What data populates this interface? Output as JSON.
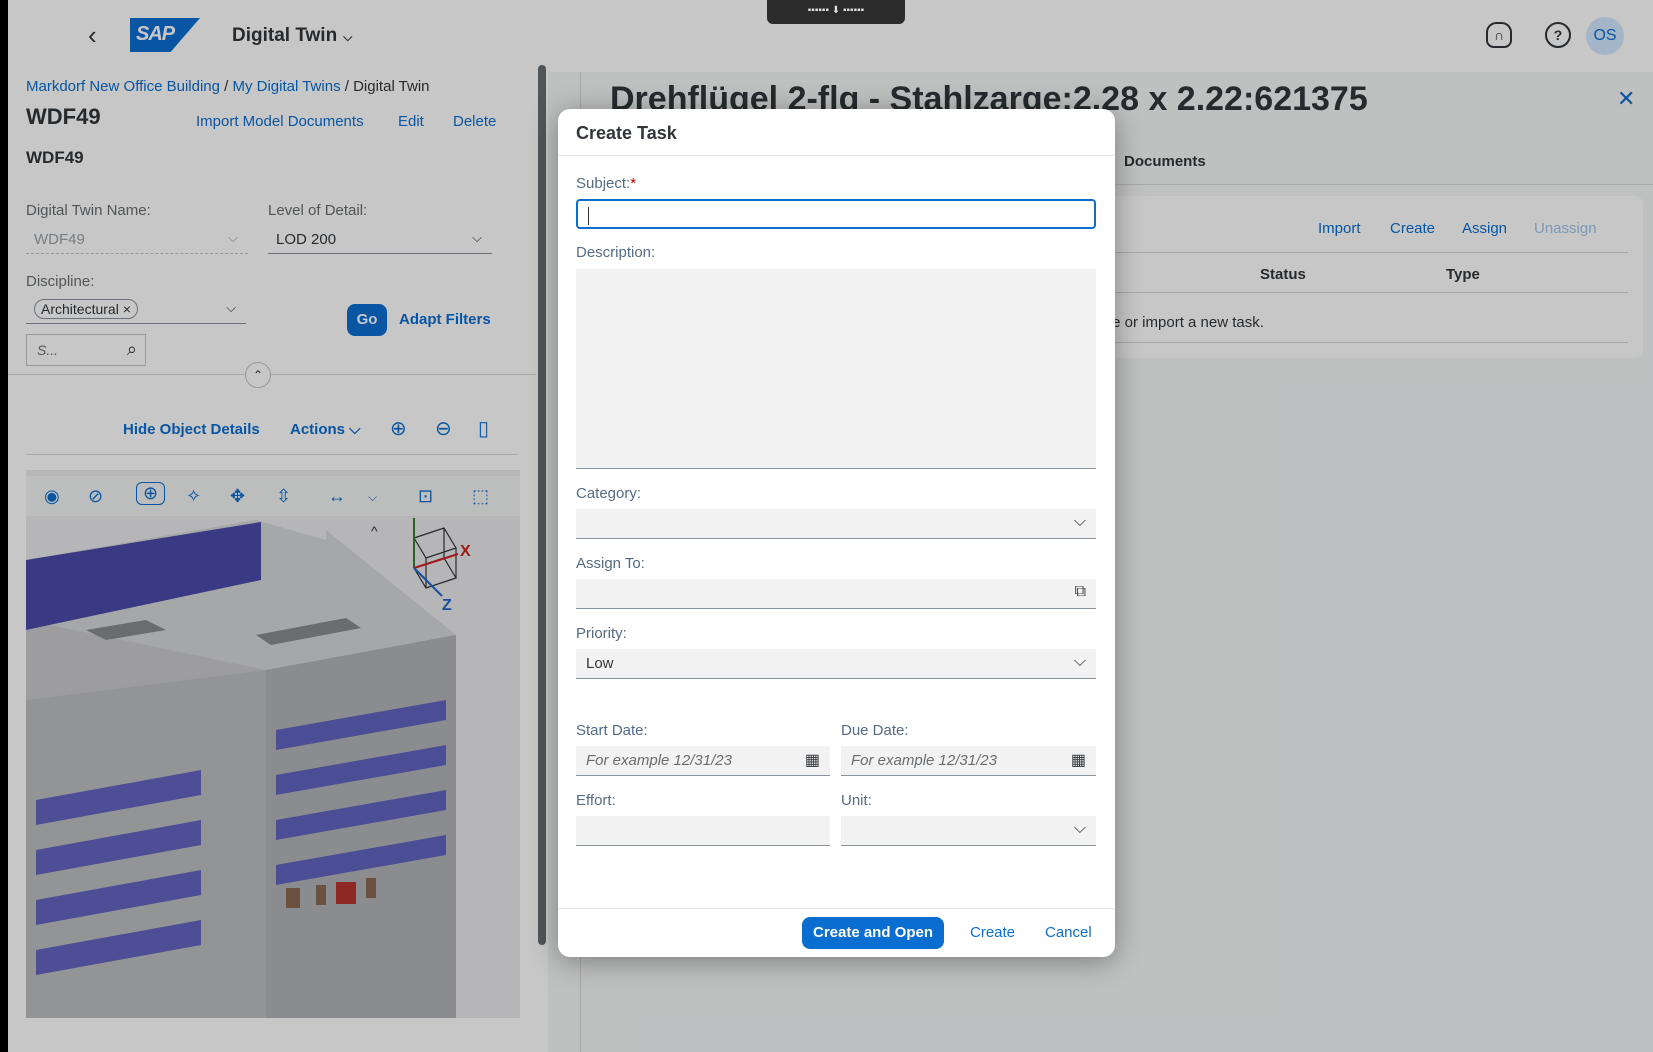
{
  "shell": {
    "app_title": "Digital Twin",
    "avatar_initials": "OS",
    "notch_text": "▪▪▪▪▪▪ ⬇ ▪▪▪▪▪▪"
  },
  "breadcrumb": {
    "items": [
      "Markdorf New Office Building",
      "My Digital Twins"
    ],
    "current": "Digital Twin",
    "separator": " / "
  },
  "header": {
    "title": "WDF49",
    "subtitle": "WDF49",
    "actions": [
      "Import Model Documents",
      "Edit",
      "Delete"
    ]
  },
  "filters": {
    "name_label": "Digital Twin Name:",
    "name_value": "WDF49",
    "lod_label": "Level of Detail:",
    "lod_value": "LOD 200",
    "discipline_label": "Discipline:",
    "discipline_token": "Architectural",
    "go_label": "Go",
    "adapt_label": "Adapt Filters",
    "search_placeholder": "S..."
  },
  "viewer_toolbar": {
    "hide_details": "Hide Object Details",
    "actions": "Actions"
  },
  "object_panel": {
    "title": "Drehflügel 2-flg - Stahlzarge:2.28 x 2.22:621375",
    "tab": "Documents",
    "tasks": {
      "actions": [
        "Import",
        "Create",
        "Assign",
        "Unassign"
      ],
      "columns": [
        "Status",
        "Type"
      ],
      "empty_text": "te or import a new task."
    }
  },
  "dialog": {
    "title": "Create Task",
    "subject_label": "Subject:",
    "required_marker": "*",
    "description_label": "Description:",
    "category_label": "Category:",
    "assign_label": "Assign To:",
    "priority_label": "Priority:",
    "priority_value": "Low",
    "start_label": "Start Date:",
    "start_placeholder": "For example 12/31/23",
    "due_label": "Due Date:",
    "due_placeholder": "For example 12/31/23",
    "effort_label": "Effort:",
    "unit_label": "Unit:",
    "buttons": {
      "create_open": "Create and Open",
      "create": "Create",
      "cancel": "Cancel"
    }
  },
  "colors": {
    "brand": "#0a6ed1",
    "text": "#32363a",
    "required": "#bb0000"
  },
  "icons": [
    "back-icon",
    "sap-logo",
    "headset-icon",
    "help-icon",
    "search-icon",
    "zoom-in-icon",
    "zoom-out-icon",
    "panel-icon",
    "chevron-down-icon",
    "calendar-icon",
    "value-help-icon",
    "close-icon"
  ]
}
